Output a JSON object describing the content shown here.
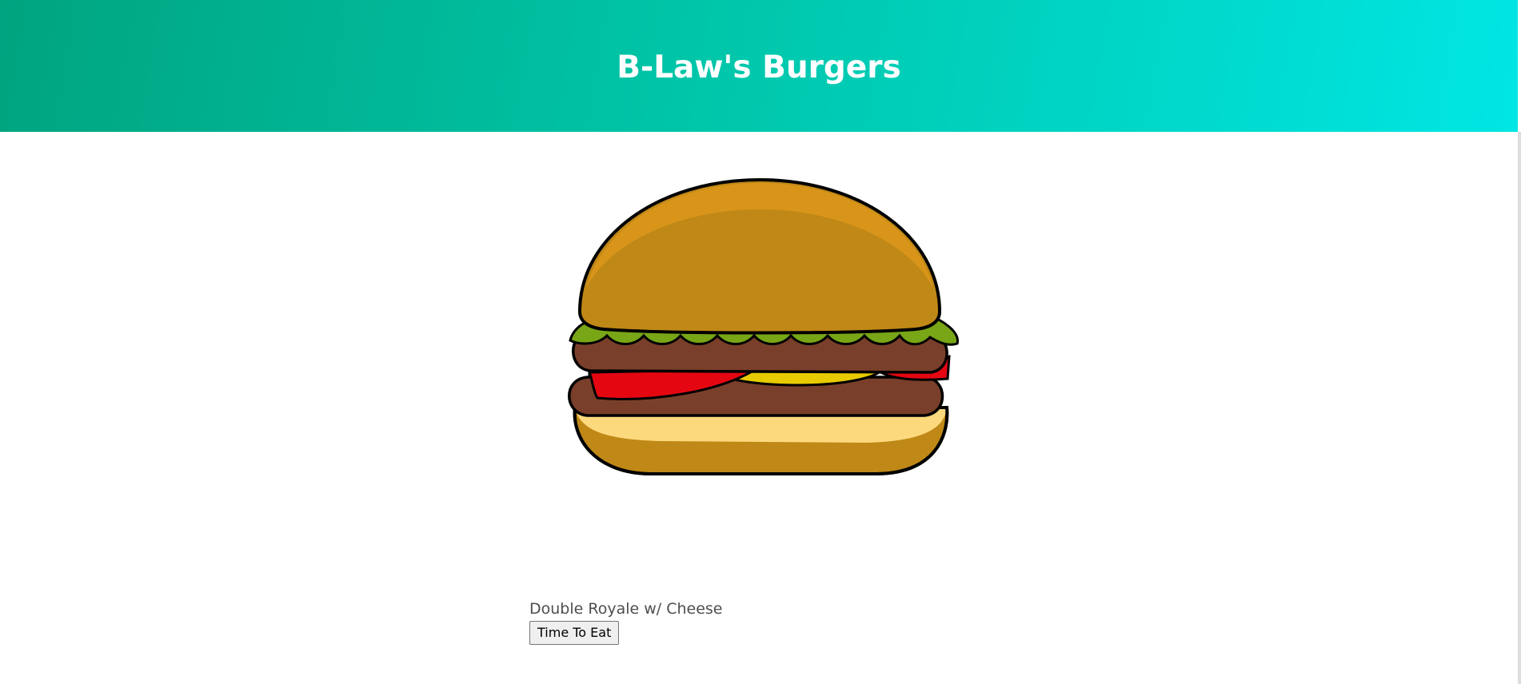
{
  "header": {
    "title": "B-Law's Burgers",
    "gradient_colors": [
      "#00a47f",
      "#00c7ab",
      "#00e6e4"
    ]
  },
  "main": {
    "image": {
      "icon": "burger-illustration",
      "colors": {
        "bun": "#c08816",
        "bun_highlight": "#d8951a",
        "lettuce": "#78a617",
        "patty": "#7a3f2a",
        "tomato": "#e40712",
        "cheese": "#e7cb00",
        "onion_orange": "#e8600a",
        "bottom_bun_inner": "#fdd97e",
        "outline": "#000000"
      }
    },
    "burgers": [
      {
        "name": "Double Royale w/ Cheese",
        "button_label": "Time To Eat"
      }
    ]
  }
}
